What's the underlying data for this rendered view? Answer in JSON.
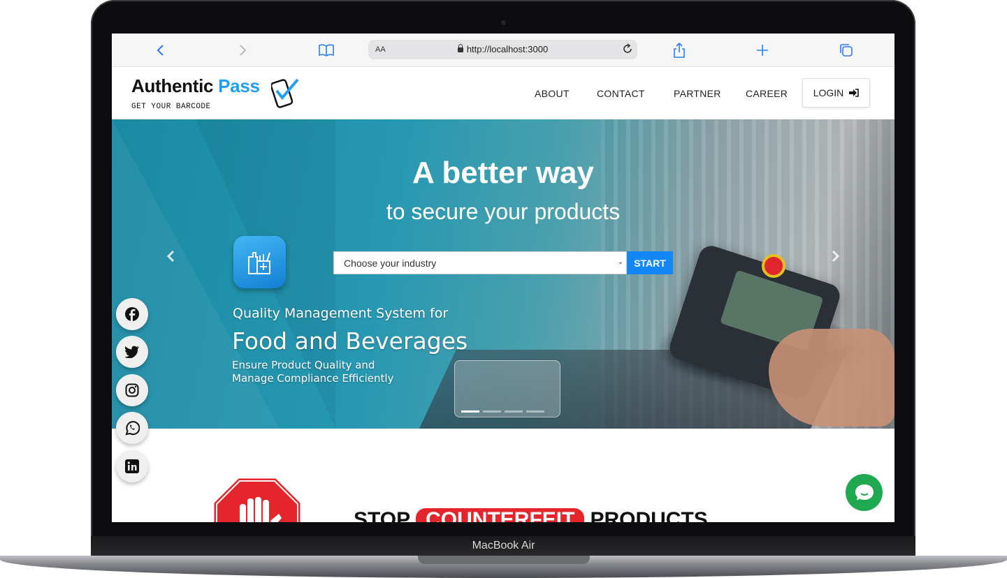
{
  "device": {
    "label": "MacBook Air"
  },
  "browser": {
    "url_aa": "AA",
    "url": "http://localhost:3000"
  },
  "header": {
    "logo_main": "Authentic",
    "logo_accent": "Pass",
    "tagline": "GET YOUR BARCODE",
    "nav": [
      {
        "label": "ABOUT"
      },
      {
        "label": "CONTACT"
      },
      {
        "label": "PARTNER"
      },
      {
        "label": "CAREER"
      }
    ],
    "login_label": "LOGIN"
  },
  "hero": {
    "title": "A better way",
    "subtitle": "to secure your products",
    "select_placeholder": "Choose your industry",
    "start_label": "START",
    "qms_label": "Quality Management System  for",
    "industry": "Food and Beverages",
    "blurb_line1": "Ensure Product Quality and",
    "blurb_line2": "Manage Compliance Efficiently",
    "slides": 4,
    "active_slide": 1
  },
  "social": [
    "facebook-icon",
    "twitter-icon",
    "instagram-icon",
    "whatsapp-icon",
    "linkedin-icon"
  ],
  "section": {
    "stop": "STOP",
    "counterfeit": "COUNTERFEIT",
    "products": "PRODUCTS"
  },
  "colors": {
    "accent": "#1e9ff2",
    "start_button": "#1487f6",
    "counterfeit": "#e4252b",
    "chat": "#1fa84f"
  }
}
